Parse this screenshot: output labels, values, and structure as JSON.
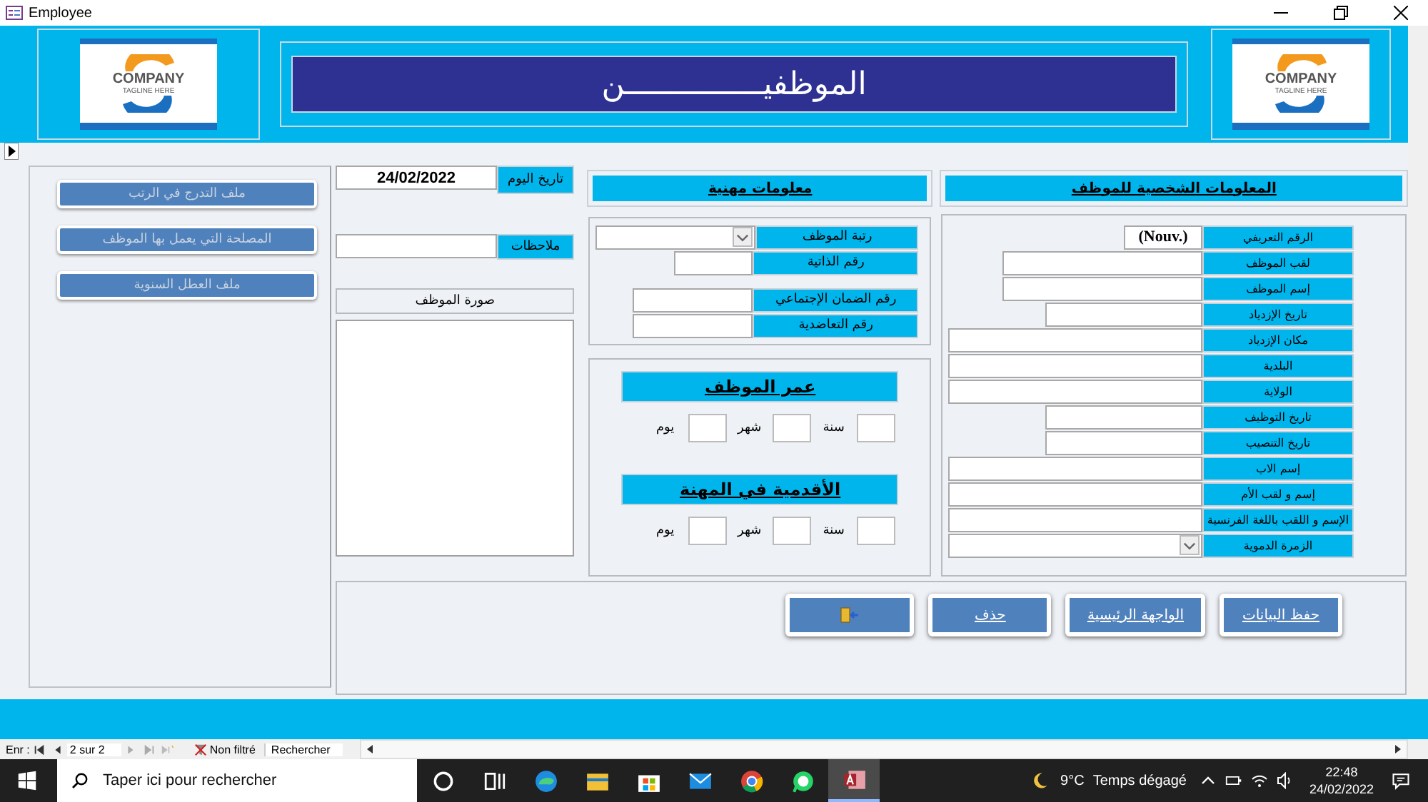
{
  "window": {
    "title": "Employee"
  },
  "header": {
    "left_logo": {
      "name": "COMPANY",
      "tagline": "TAGLINE HERE"
    },
    "title": "الموظفيـــــــــــــــن",
    "right_logo": {
      "name": "COMPANY",
      "tagline": "TAGLINE HERE"
    }
  },
  "side_buttons": [
    {
      "label": "ملف التدرج في الرتب",
      "disabled": true
    },
    {
      "label": "المصلحة التي يعمل بها الموظف",
      "disabled": true
    },
    {
      "label": "ملف العطل السنوية",
      "disabled": true
    }
  ],
  "today": {
    "label": "تاريخ اليوم",
    "value": "24/02/2022"
  },
  "notes": {
    "label": "ملاحظات"
  },
  "photo": {
    "caption": "صورة الموظف"
  },
  "professional": {
    "title": "معلومات مهنية",
    "fields": [
      {
        "label": "رتبة الموظف",
        "kind": "combo"
      },
      {
        "label": "رقم الذاتية",
        "kind": "text"
      },
      {
        "label": "رقم الضمان الإجتماعي",
        "kind": "text"
      },
      {
        "label": "رقم التعاضدية",
        "kind": "text"
      }
    ],
    "durations": [
      {
        "title": "عمر الموظف",
        "units": [
          "سنة",
          "شهر",
          "يوم"
        ]
      },
      {
        "title": "الأقدمية في المهنة",
        "units": [
          "سنة",
          "شهر",
          "يوم"
        ]
      }
    ]
  },
  "personal": {
    "title": "المعلومات الشخصية للموظف",
    "fields": [
      {
        "label": "الرقم التعريفي",
        "kind": "text",
        "value": "(Nouv.)"
      },
      {
        "label": "لقب الموظف",
        "kind": "text"
      },
      {
        "label": "إسم الموظف",
        "kind": "text"
      },
      {
        "label": "تاريخ الإزدياد",
        "kind": "text"
      },
      {
        "label": "مكان الإزدياد",
        "kind": "text"
      },
      {
        "label": "البلدية",
        "kind": "text"
      },
      {
        "label": "الولاية",
        "kind": "text"
      },
      {
        "label": "تاريخ التوظيف",
        "kind": "text"
      },
      {
        "label": "تاريخ التنصيب",
        "kind": "text"
      },
      {
        "label": "إسم الاب",
        "kind": "text"
      },
      {
        "label": "إسم و لقب الأم",
        "kind": "text"
      },
      {
        "label": "الإسم و اللقب باللغة الفرنسية",
        "kind": "text"
      },
      {
        "label": "الزمرة الدموية",
        "kind": "combo"
      }
    ]
  },
  "actions": [
    {
      "kind": "text",
      "label": "حفظ البيانات"
    },
    {
      "kind": "text",
      "label": "الواجهة الرئيسية"
    },
    {
      "kind": "text",
      "label": "حذف"
    },
    {
      "kind": "exit"
    }
  ],
  "navigation": {
    "label": "Enr :",
    "position": "2 sur 2",
    "filter": "Non filtré",
    "search_placeholder": "Rechercher"
  },
  "taskbar": {
    "search_placeholder": "Taper ici pour rechercher",
    "apps": [
      {
        "kind": "cortana",
        "selected": false
      },
      {
        "kind": "taskview",
        "selected": false
      },
      {
        "kind": "edge",
        "selected": false
      },
      {
        "kind": "explorer",
        "selected": false
      },
      {
        "kind": "store",
        "selected": false
      },
      {
        "kind": "mail",
        "selected": false
      },
      {
        "kind": "chrome",
        "selected": false
      },
      {
        "kind": "whatsapp",
        "selected": false
      },
      {
        "kind": "access",
        "selected": true
      }
    ],
    "temperature": "9°C",
    "weather": "Temps dégagé",
    "time": "22:48",
    "date": "24/02/2022"
  }
}
